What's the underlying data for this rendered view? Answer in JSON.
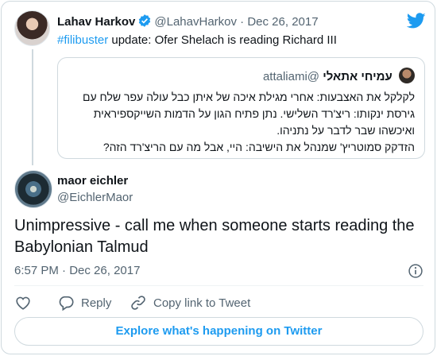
{
  "parent_tweet": {
    "name": "Lahav Harkov",
    "handle": "@LahavHarkov",
    "separator": "·",
    "date": "Dec 26, 2017",
    "hashtag": "#filibuster",
    "text": " update: Ofer Shelach is reading Richard III"
  },
  "quoted_tweet": {
    "name": "עמיחי אתאלי",
    "handle": "@attaliami",
    "lines": [
      "לקלקל את האצבעות: אחרי מגילת איכה של איתן כבל עולה עפר שלח עם",
      "גירסת ינקותו: ריצ'רד השלישי. נתן פתיח הגון על הדמות השייקספיראית",
      "ואיכשהו שבר לדבר על נתניהו.",
      "הזדקק סמוטריץ' שמנהל את הישיבה: היי, אבל מה עם הריצ'רד הזה?"
    ]
  },
  "main_tweet": {
    "name": "maor eichler",
    "handle": "@EichlerMaor",
    "text": "Unimpressive - call me when someone starts reading the Babylonian Talmud",
    "time": "6:57 PM",
    "separator": "·",
    "date": "Dec 26, 2017"
  },
  "actions": {
    "reply_label": "Reply",
    "copy_link_label": "Copy link to Tweet"
  },
  "explore_label": "Explore what's happening on Twitter",
  "colors": {
    "brand_blue": "#1d9bf0",
    "muted_text": "#536471",
    "border": "#cfd9de"
  },
  "icons": [
    "verified-badge-icon",
    "twitter-bird-icon",
    "info-icon",
    "heart-icon",
    "reply-bubble-icon",
    "link-icon"
  ]
}
